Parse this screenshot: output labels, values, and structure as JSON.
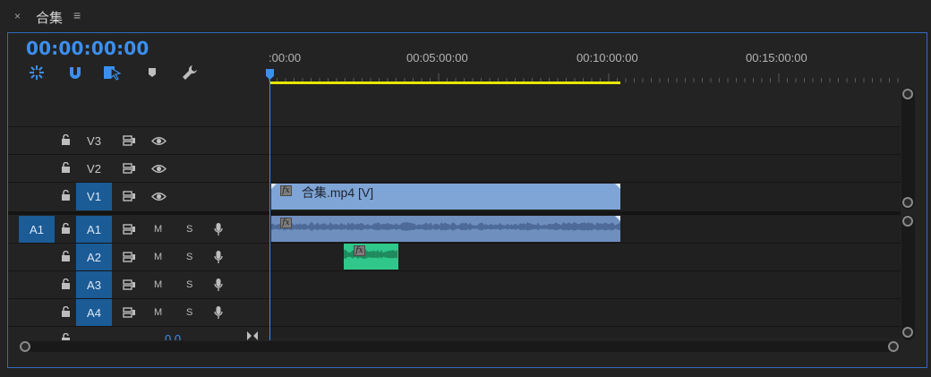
{
  "panel": {
    "close_glyph": "×",
    "title": "合集",
    "menu_glyph": "≡",
    "timecode": "00:00:00:00"
  },
  "toolbar": [
    {
      "name": "insert-nest-sequence-icon"
    },
    {
      "name": "snap-magnet-icon"
    },
    {
      "name": "linked-selection-icon"
    },
    {
      "name": "add-marker-icon"
    },
    {
      "name": "timeline-settings-wrench-icon"
    }
  ],
  "ruler": {
    "labels": [
      ":00:00",
      "00:05:00:00",
      "00:10:00:00",
      "00:15:00:00"
    ]
  },
  "tracks": {
    "video": [
      {
        "label": "V3",
        "active": false
      },
      {
        "label": "V2",
        "active": false
      },
      {
        "label": "V1",
        "active": true
      }
    ],
    "audio": [
      {
        "label": "A1",
        "source": "A1",
        "active": true
      },
      {
        "label": "A2",
        "active": true
      },
      {
        "label": "A3",
        "active": true
      },
      {
        "label": "A4",
        "active": true
      }
    ],
    "mute_label": "M",
    "solo_label": "S",
    "master_value": "0.0"
  },
  "clips": {
    "video_clip_name": "合集.mp4 [V]",
    "fx_label": "fx"
  },
  "colors": {
    "accent": "#3b8ff0",
    "work_area": "#e6e600",
    "video_clip": "#7fa5d6",
    "audio_clip": "#6f8fbf",
    "green_clip": "#2fc88a"
  }
}
